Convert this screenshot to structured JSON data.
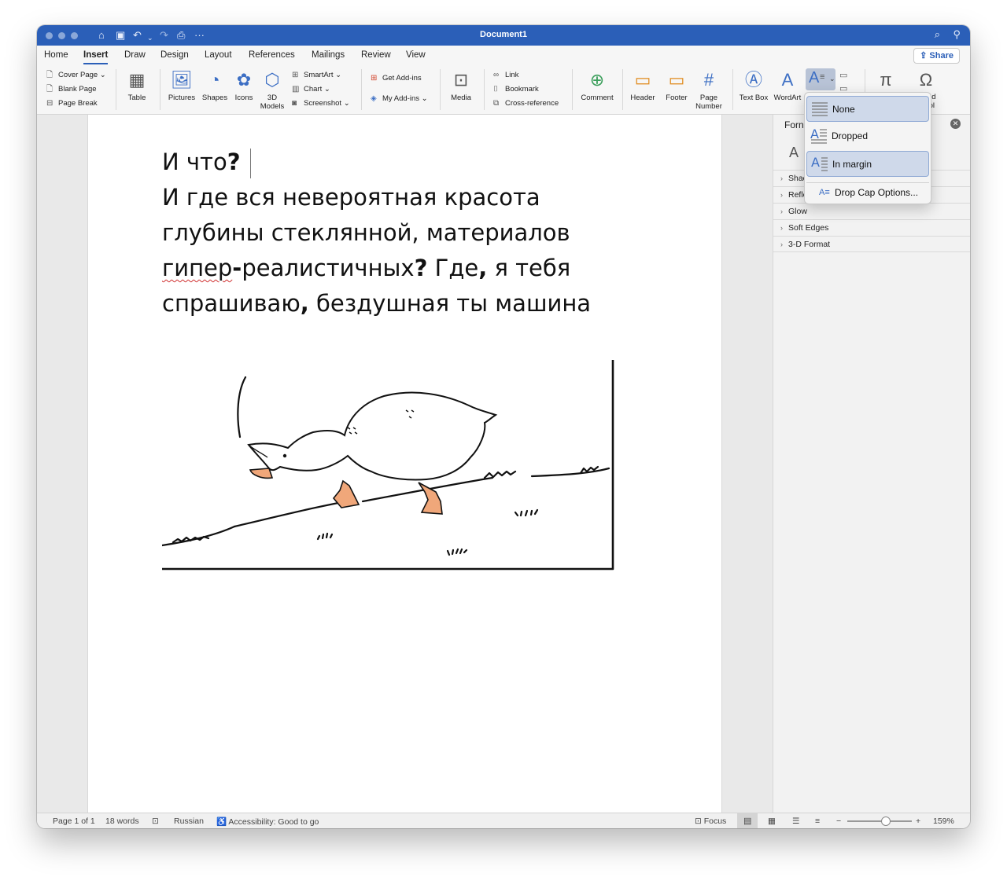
{
  "window": {
    "title": "Document1",
    "quick_access": [
      "home-icon",
      "save-icon",
      "undo-icon",
      "redo-icon",
      "print-icon",
      "more-icon"
    ],
    "more_label": "···"
  },
  "ribbon": {
    "tabs": [
      "Home",
      "Insert",
      "Draw",
      "Design",
      "Layout",
      "References",
      "Mailings",
      "Review",
      "View"
    ],
    "active_tab": "Insert",
    "share_label": "Share",
    "pages": {
      "cover": "Cover Page",
      "blank": "Blank Page",
      "break": "Page Break"
    },
    "table": "Table",
    "pictures": "Pictures",
    "shapes": "Shapes",
    "icons": "Icons",
    "models": "3D Models",
    "smartart": "SmartArt",
    "chart": "Chart",
    "screenshot": "Screenshot",
    "get_addins": "Get Add-ins",
    "my_addins": "My Add-ins",
    "media": "Media",
    "link": "Link",
    "bookmark": "Bookmark",
    "crossref": "Cross-reference",
    "comment": "Comment",
    "header": "Header",
    "footer": "Footer",
    "page_number": "Page Number",
    "textbox": "Text Box",
    "wordart": "WordArt",
    "symbol_partial": "ed\nol"
  },
  "document": {
    "line1_text": "И что",
    "line1_mark": "?",
    "p2_a": "И где вся невероятная красота глубины стеклянной, материалов ",
    "p2_word": "гипер",
    "p2_dash": "-",
    "p2_b": "реалистичных",
    "p2_q": "?",
    "p2_c": " Где",
    "p2_comma": ",",
    "p2_d": " я тебя спрашиваю",
    "p2_comma2": ",",
    "p2_e": " бездушная ты машина"
  },
  "format_pane": {
    "title_partial": "Forn",
    "tab_icon": "A",
    "sections": [
      "Shac",
      "Refle",
      "Glow",
      "Soft Edges",
      "3-D Format"
    ]
  },
  "drop_cap_menu": {
    "items": [
      "None",
      "Dropped",
      "In margin"
    ],
    "selected": "In margin",
    "hovered": "None",
    "options_label": "Drop Cap Options..."
  },
  "status_bar": {
    "page": "Page 1 of 1",
    "words": "18 words",
    "language": "Russian",
    "accessibility": "Accessibility: Good to go",
    "focus": "Focus",
    "zoom": "159%",
    "zoom_level": 0.6
  },
  "colors": {
    "titlebar": "#2b5fb8",
    "accent": "#2b5fb8",
    "selection": "#cfd9ea"
  }
}
